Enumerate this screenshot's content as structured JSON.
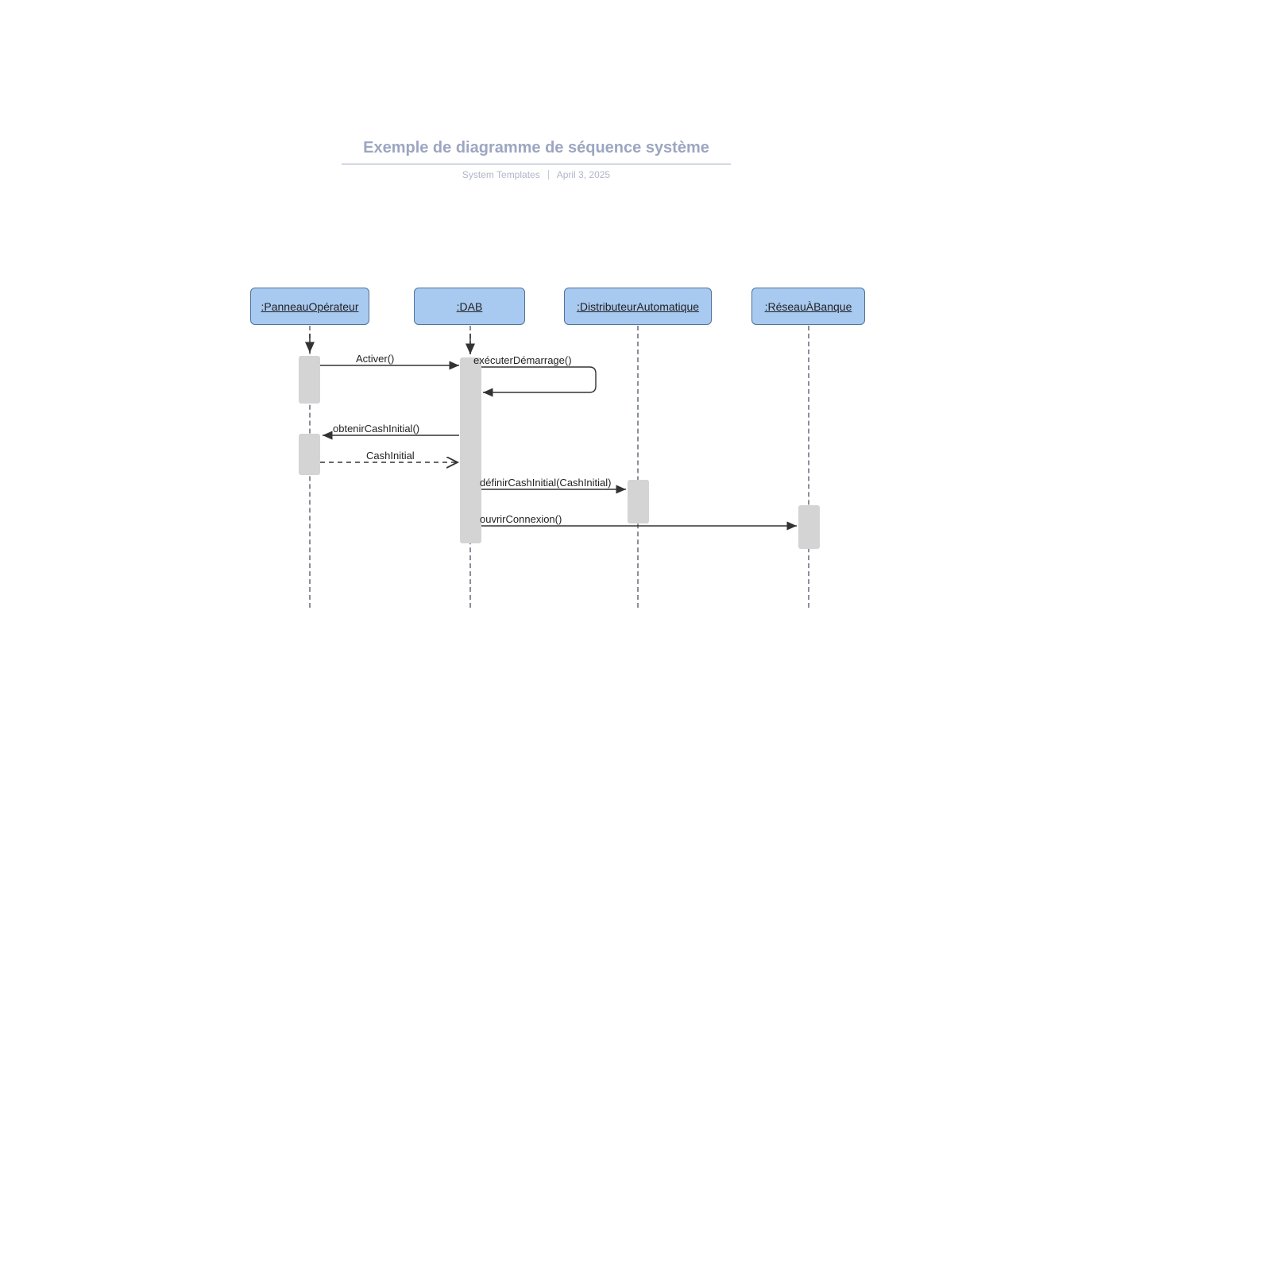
{
  "header": {
    "title": "Exemple de diagramme de séquence système",
    "author": "System Templates",
    "date": "April 3, 2025"
  },
  "objects": {
    "op": {
      "label": ":PanneauOpérateur"
    },
    "dab": {
      "label": ":DAB"
    },
    "da": {
      "label": ":DistributeurAutomatique"
    },
    "rb": {
      "label": ":RéseauÀBanque"
    }
  },
  "messages": {
    "activer": "Activer()",
    "execStart": "exécuterDémarrage()",
    "getCash": "obtenirCashInitial()",
    "cashInit": "CashInitial",
    "setCash": "définirCashInitial(CashInitial)",
    "openConn": "ouvrirConnexion()"
  }
}
